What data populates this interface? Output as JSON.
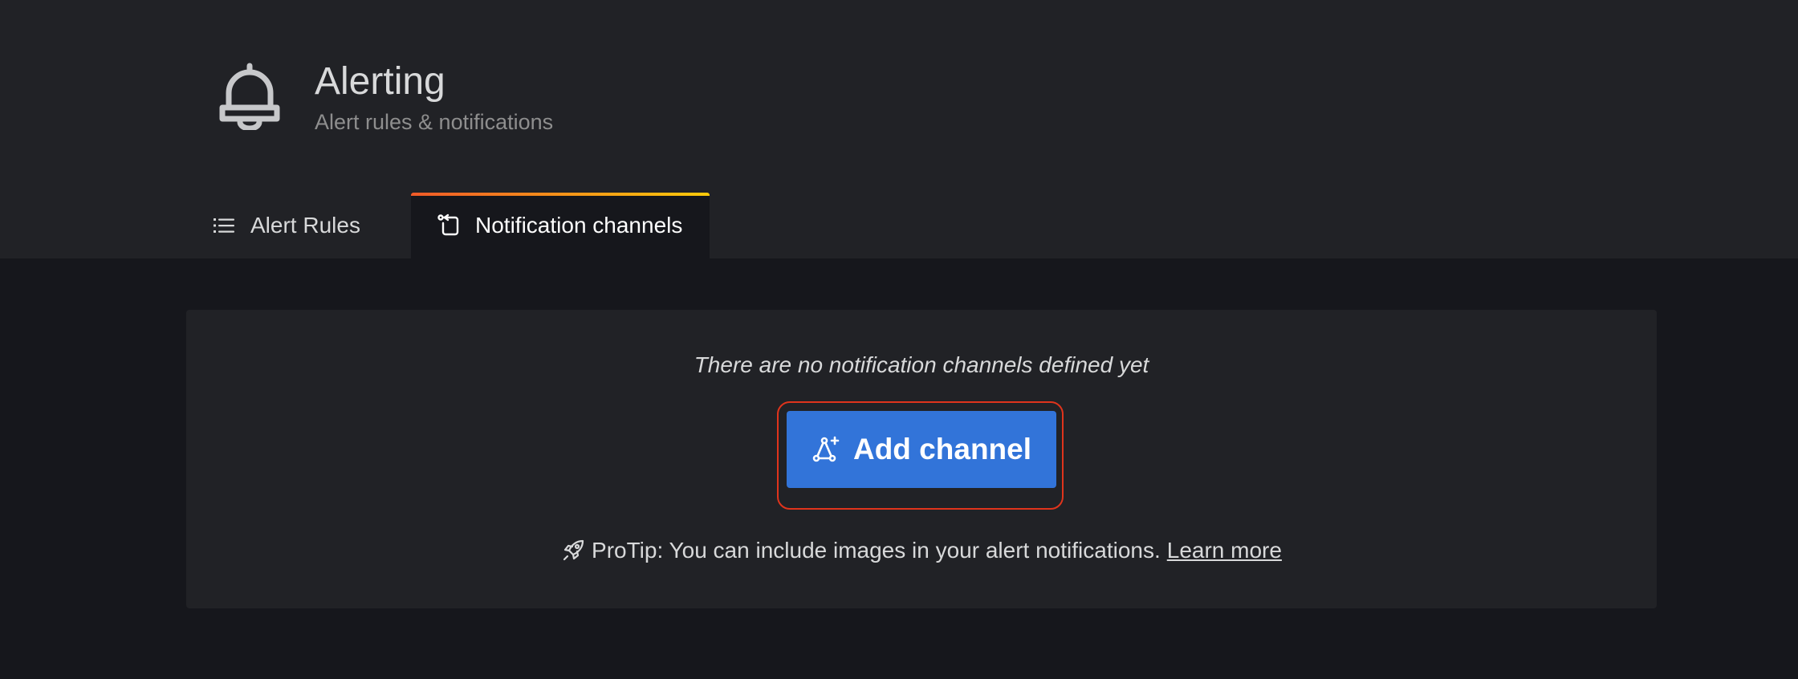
{
  "header": {
    "title": "Alerting",
    "subtitle": "Alert rules & notifications",
    "icon": "bell-icon"
  },
  "tabs": [
    {
      "label": "Alert Rules",
      "icon": "list-icon",
      "active": false
    },
    {
      "label": "Notification channels",
      "icon": "channels-icon",
      "active": true
    }
  ],
  "empty_state": {
    "message": "There are no notification channels defined yet",
    "button_label": "Add channel",
    "button_icon": "comment-alt-share-icon",
    "tip_icon": "rocket-icon",
    "tip_text": "ProTip: You can include images in your alert notifications.",
    "tip_link": "Learn more"
  },
  "colors": {
    "background": "#16171c",
    "panel": "#212226",
    "primary_button": "#3274d9",
    "focus_ring": "#e0341c",
    "tab_gradient_start": "#f05a28",
    "tab_gradient_end": "#fbca0a"
  }
}
